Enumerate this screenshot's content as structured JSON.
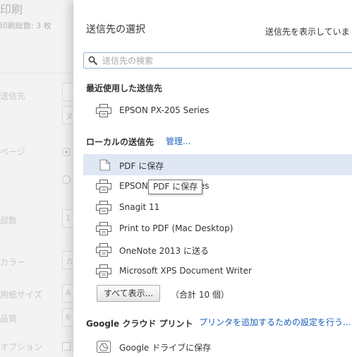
{
  "background": {
    "title": "印刷",
    "total": "印刷総数: 3 枚",
    "labels": {
      "destination": "送信先",
      "pages": "ページ",
      "copies": "部数",
      "color": "カラー",
      "paper_size": "用紙サイズ",
      "quality": "品質",
      "options": "オプション"
    },
    "values": {
      "destination_fragment": "ヌ",
      "copies_value": "1",
      "color_value": "カ",
      "paper_value": "A",
      "quality_value": "6"
    }
  },
  "dialog": {
    "title": "送信先の選択",
    "status": "送信先を表示していま",
    "search_placeholder": "送信先の検索",
    "search_value": "",
    "recent_heading": "最近使用した送信先",
    "recent": [
      {
        "name": "EPSON PX-205 Series",
        "icon": "printer-icon"
      }
    ],
    "local_heading": "ローカルの送信先",
    "manage_link": "管理...",
    "local": [
      {
        "name": "PDF に保存",
        "icon": "document-icon",
        "selected": true
      },
      {
        "name": "EPSON PX-205 Series",
        "icon": "printer-icon"
      },
      {
        "name": "Snagit 11",
        "icon": "printer-icon"
      },
      {
        "name": "Print to PDF (Mac Desktop)",
        "icon": "printer-icon"
      },
      {
        "name": "OneNote 2013 に送る",
        "icon": "printer-icon"
      },
      {
        "name": "Microsoft XPS Document Writer",
        "icon": "printer-icon"
      }
    ],
    "show_all_label": "すべて表示...",
    "count_text": "（合計 10 個）",
    "cloud_heading": "Google クラウド プリント",
    "cloud_link": "プリンタを追加するための設定を行う...",
    "cloud": [
      {
        "name": "Google ドライブに保存",
        "icon": "google-drive-icon"
      }
    ],
    "tooltip": "PDF に保存"
  },
  "colors": {
    "link": "#1a5fbd",
    "selected_row": "#dfe7f5",
    "search_border": "#9ab0d0"
  }
}
